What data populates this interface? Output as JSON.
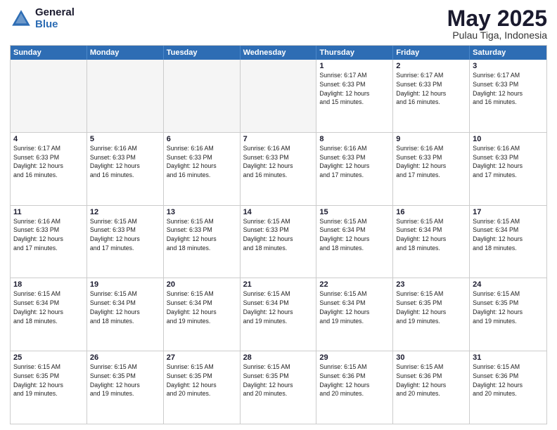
{
  "logo": {
    "general": "General",
    "blue": "Blue"
  },
  "header": {
    "month": "May 2025",
    "location": "Pulau Tiga, Indonesia"
  },
  "days": [
    "Sunday",
    "Monday",
    "Tuesday",
    "Wednesday",
    "Thursday",
    "Friday",
    "Saturday"
  ],
  "weeks": [
    [
      {
        "day": "",
        "text": ""
      },
      {
        "day": "",
        "text": ""
      },
      {
        "day": "",
        "text": ""
      },
      {
        "day": "",
        "text": ""
      },
      {
        "day": "1",
        "text": "Sunrise: 6:17 AM\nSunset: 6:33 PM\nDaylight: 12 hours\nand 15 minutes."
      },
      {
        "day": "2",
        "text": "Sunrise: 6:17 AM\nSunset: 6:33 PM\nDaylight: 12 hours\nand 16 minutes."
      },
      {
        "day": "3",
        "text": "Sunrise: 6:17 AM\nSunset: 6:33 PM\nDaylight: 12 hours\nand 16 minutes."
      }
    ],
    [
      {
        "day": "4",
        "text": "Sunrise: 6:17 AM\nSunset: 6:33 PM\nDaylight: 12 hours\nand 16 minutes."
      },
      {
        "day": "5",
        "text": "Sunrise: 6:16 AM\nSunset: 6:33 PM\nDaylight: 12 hours\nand 16 minutes."
      },
      {
        "day": "6",
        "text": "Sunrise: 6:16 AM\nSunset: 6:33 PM\nDaylight: 12 hours\nand 16 minutes."
      },
      {
        "day": "7",
        "text": "Sunrise: 6:16 AM\nSunset: 6:33 PM\nDaylight: 12 hours\nand 16 minutes."
      },
      {
        "day": "8",
        "text": "Sunrise: 6:16 AM\nSunset: 6:33 PM\nDaylight: 12 hours\nand 17 minutes."
      },
      {
        "day": "9",
        "text": "Sunrise: 6:16 AM\nSunset: 6:33 PM\nDaylight: 12 hours\nand 17 minutes."
      },
      {
        "day": "10",
        "text": "Sunrise: 6:16 AM\nSunset: 6:33 PM\nDaylight: 12 hours\nand 17 minutes."
      }
    ],
    [
      {
        "day": "11",
        "text": "Sunrise: 6:16 AM\nSunset: 6:33 PM\nDaylight: 12 hours\nand 17 minutes."
      },
      {
        "day": "12",
        "text": "Sunrise: 6:15 AM\nSunset: 6:33 PM\nDaylight: 12 hours\nand 17 minutes."
      },
      {
        "day": "13",
        "text": "Sunrise: 6:15 AM\nSunset: 6:33 PM\nDaylight: 12 hours\nand 18 minutes."
      },
      {
        "day": "14",
        "text": "Sunrise: 6:15 AM\nSunset: 6:33 PM\nDaylight: 12 hours\nand 18 minutes."
      },
      {
        "day": "15",
        "text": "Sunrise: 6:15 AM\nSunset: 6:34 PM\nDaylight: 12 hours\nand 18 minutes."
      },
      {
        "day": "16",
        "text": "Sunrise: 6:15 AM\nSunset: 6:34 PM\nDaylight: 12 hours\nand 18 minutes."
      },
      {
        "day": "17",
        "text": "Sunrise: 6:15 AM\nSunset: 6:34 PM\nDaylight: 12 hours\nand 18 minutes."
      }
    ],
    [
      {
        "day": "18",
        "text": "Sunrise: 6:15 AM\nSunset: 6:34 PM\nDaylight: 12 hours\nand 18 minutes."
      },
      {
        "day": "19",
        "text": "Sunrise: 6:15 AM\nSunset: 6:34 PM\nDaylight: 12 hours\nand 18 minutes."
      },
      {
        "day": "20",
        "text": "Sunrise: 6:15 AM\nSunset: 6:34 PM\nDaylight: 12 hours\nand 19 minutes."
      },
      {
        "day": "21",
        "text": "Sunrise: 6:15 AM\nSunset: 6:34 PM\nDaylight: 12 hours\nand 19 minutes."
      },
      {
        "day": "22",
        "text": "Sunrise: 6:15 AM\nSunset: 6:34 PM\nDaylight: 12 hours\nand 19 minutes."
      },
      {
        "day": "23",
        "text": "Sunrise: 6:15 AM\nSunset: 6:35 PM\nDaylight: 12 hours\nand 19 minutes."
      },
      {
        "day": "24",
        "text": "Sunrise: 6:15 AM\nSunset: 6:35 PM\nDaylight: 12 hours\nand 19 minutes."
      }
    ],
    [
      {
        "day": "25",
        "text": "Sunrise: 6:15 AM\nSunset: 6:35 PM\nDaylight: 12 hours\nand 19 minutes."
      },
      {
        "day": "26",
        "text": "Sunrise: 6:15 AM\nSunset: 6:35 PM\nDaylight: 12 hours\nand 19 minutes."
      },
      {
        "day": "27",
        "text": "Sunrise: 6:15 AM\nSunset: 6:35 PM\nDaylight: 12 hours\nand 20 minutes."
      },
      {
        "day": "28",
        "text": "Sunrise: 6:15 AM\nSunset: 6:35 PM\nDaylight: 12 hours\nand 20 minutes."
      },
      {
        "day": "29",
        "text": "Sunrise: 6:15 AM\nSunset: 6:36 PM\nDaylight: 12 hours\nand 20 minutes."
      },
      {
        "day": "30",
        "text": "Sunrise: 6:15 AM\nSunset: 6:36 PM\nDaylight: 12 hours\nand 20 minutes."
      },
      {
        "day": "31",
        "text": "Sunrise: 6:15 AM\nSunset: 6:36 PM\nDaylight: 12 hours\nand 20 minutes."
      }
    ]
  ]
}
